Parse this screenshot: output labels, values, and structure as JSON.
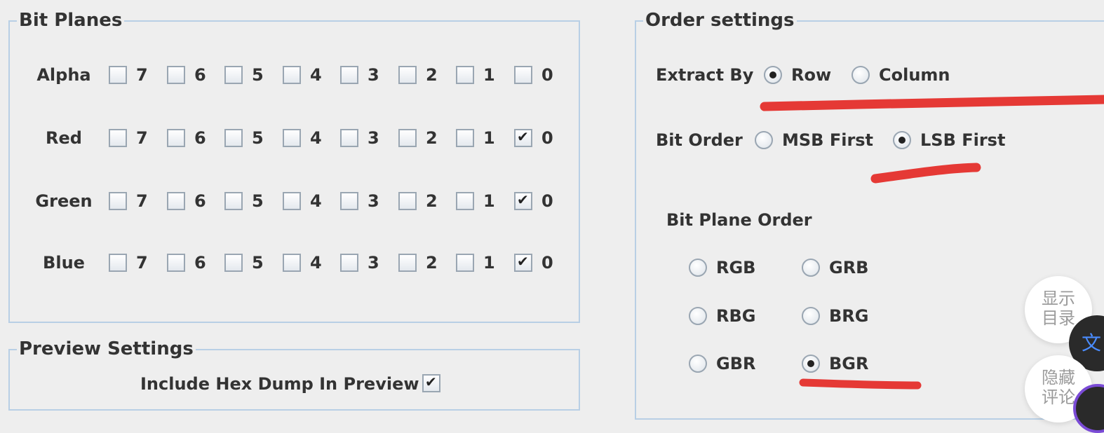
{
  "bit_planes": {
    "title": "Bit Planes",
    "bit_labels": [
      "7",
      "6",
      "5",
      "4",
      "3",
      "2",
      "1",
      "0"
    ],
    "channels": [
      {
        "name": "Alpha",
        "checked": [
          false,
          false,
          false,
          false,
          false,
          false,
          false,
          false
        ]
      },
      {
        "name": "Red",
        "checked": [
          false,
          false,
          false,
          false,
          false,
          false,
          false,
          true
        ]
      },
      {
        "name": "Green",
        "checked": [
          false,
          false,
          false,
          false,
          false,
          false,
          false,
          true
        ]
      },
      {
        "name": "Blue",
        "checked": [
          false,
          false,
          false,
          false,
          false,
          false,
          false,
          true
        ]
      }
    ]
  },
  "preview_settings": {
    "title": "Preview Settings",
    "hex_dump_label": "Include Hex Dump In Preview",
    "hex_dump_checked": true
  },
  "order_settings": {
    "title": "Order settings",
    "extract_by": {
      "label": "Extract By",
      "options": [
        "Row",
        "Column"
      ],
      "selected": "Row"
    },
    "bit_order": {
      "label": "Bit Order",
      "options": [
        "MSB First",
        "LSB First"
      ],
      "selected": "LSB First"
    },
    "bit_plane_order": {
      "label": "Bit Plane Order",
      "options": [
        "RGB",
        "GRB",
        "RBG",
        "BRG",
        "GBR",
        "BGR"
      ],
      "selected": "BGR"
    }
  },
  "annotation_color": "#e53935",
  "floating": {
    "show_toc": "显示\n目录",
    "hide_comments": "隐藏\n评论",
    "translate_glyph": "文"
  }
}
